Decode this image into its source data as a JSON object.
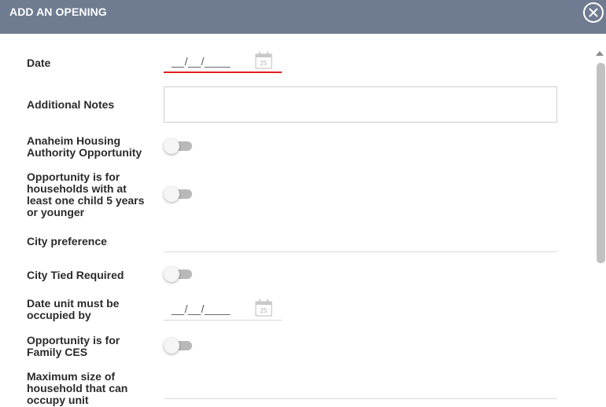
{
  "header": {
    "title": "ADD AN OPENING",
    "close_icon": "close-circle-icon"
  },
  "form": {
    "date": {
      "label": "Date",
      "value": "__/__/____",
      "icon": "calendar-icon",
      "calendar_day": "25",
      "error": true
    },
    "additional_notes": {
      "label": "Additional Notes",
      "value": ""
    },
    "anaheim_housing": {
      "label": "Anaheim Housing Authority Opportunity",
      "checked": false
    },
    "child_5_years": {
      "label": "Opportunity is for households with at least one child 5 years or younger",
      "checked": false
    },
    "city_preference": {
      "label": "City preference",
      "value": ""
    },
    "city_tied_required": {
      "label": "City Tied Required",
      "checked": false
    },
    "date_occupied": {
      "label": "Date unit must be occupied by",
      "value": "__/__/____",
      "icon": "calendar-icon",
      "calendar_day": "25"
    },
    "family_ces": {
      "label": "Opportunity is for Family CES",
      "checked": false
    },
    "max_household_size": {
      "label": "Maximum size of household that can occupy unit",
      "value": ""
    }
  },
  "colors": {
    "header_bg": "#6e7b90",
    "error_underline": "#e0201f",
    "toggle_track": "#b9b9b9"
  }
}
